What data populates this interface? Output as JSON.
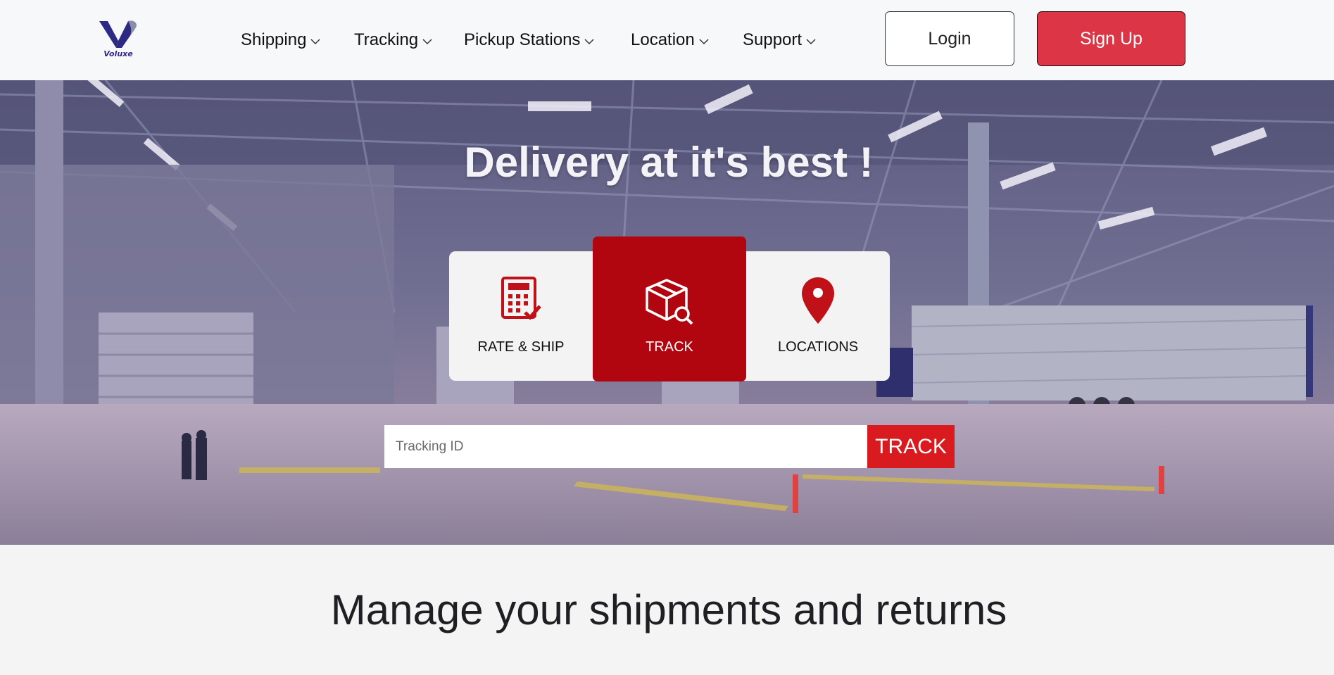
{
  "brand": {
    "name": "Voluxe",
    "primary_color": "#2d2a84",
    "accent_color": "#dc3545"
  },
  "nav": {
    "items": [
      {
        "label": "Shipping",
        "icon": "chevron-down-icon"
      },
      {
        "label": "Tracking",
        "icon": "chevron-down-icon"
      },
      {
        "label": "Pickup Stations",
        "icon": "chevron-down-icon"
      },
      {
        "label": "Location",
        "icon": "chevron-down-icon"
      },
      {
        "label": "Support",
        "icon": "chevron-down-icon"
      }
    ],
    "login_label": "Login",
    "signup_label": "Sign Up"
  },
  "hero": {
    "title": "Delivery at it's best !",
    "background": "warehouse loading dock photo",
    "services": [
      {
        "label": "RATE & SHIP",
        "icon": "calculator-check-icon"
      },
      {
        "label": "TRACK",
        "icon": "package-search-icon",
        "active": true
      },
      {
        "label": "LOCATIONS",
        "icon": "map-pin-icon"
      }
    ],
    "tracking": {
      "placeholder": "Tracking ID",
      "button_label": "TRACK"
    }
  },
  "section": {
    "title": "Manage your shipments and returns"
  }
}
